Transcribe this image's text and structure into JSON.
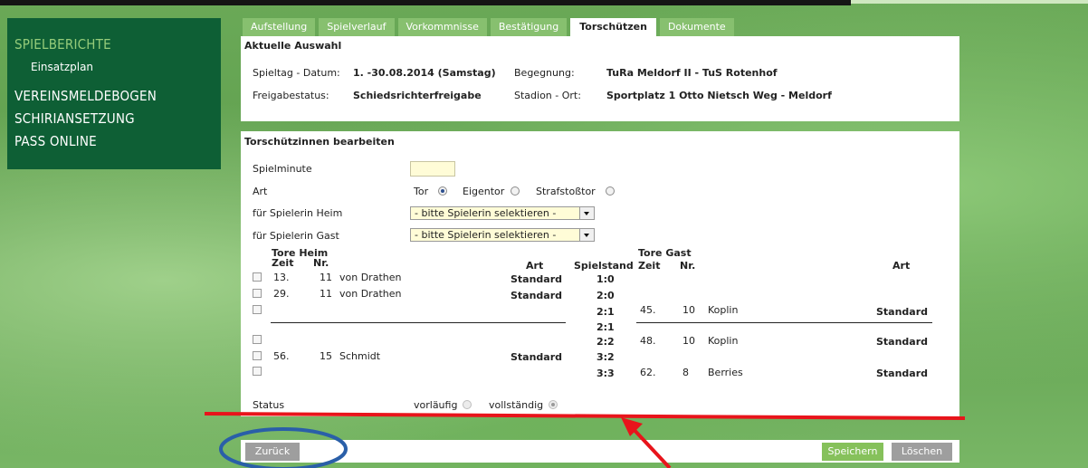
{
  "sidebar": {
    "items": [
      {
        "label": "SPIELBERICHTE"
      },
      {
        "label": "VEREINSMELDEBOGEN"
      },
      {
        "label": "SCHIRIANSETZUNG"
      },
      {
        "label": "PASS ONLINE"
      }
    ],
    "sub_item": "Einsatzplan"
  },
  "tabs": [
    {
      "label": "Aufstellung"
    },
    {
      "label": "Spielverlauf"
    },
    {
      "label": "Vorkommnisse"
    },
    {
      "label": "Bestätigung"
    },
    {
      "label": "Torschützen"
    },
    {
      "label": "Dokumente"
    }
  ],
  "selection": {
    "title": "Aktuelle Auswahl",
    "matchday_label": "Spieltag - Datum:",
    "matchday_value": "1. -30.08.2014 (Samstag)",
    "match_label": "Begegnung:",
    "match_value": "TuRa Meldorf II - TuS Rotenhof",
    "release_label": "Freigabestatus:",
    "release_value": "Schiedsrichterfreigabe",
    "venue_label": "Stadion - Ort:",
    "venue_value": "Sportplatz 1 Otto Nietsch Weg - Meldorf"
  },
  "editor": {
    "title": "Torschützinnen bearbeiten",
    "minute_label": "Spielminute",
    "minute_value": "",
    "type_label": "Art",
    "type_options": [
      "Tor",
      "Eigentor",
      "Strafstoßtor"
    ],
    "home_player_label": "für Spielerin Heim",
    "away_player_label": "für Spielerin Gast",
    "player_placeholder": "- bitte Spielerin selektieren -",
    "status_label": "Status",
    "status_options": [
      "vorläufig",
      "vollständig"
    ]
  },
  "goals": {
    "home_header": "Tore Heim",
    "away_header": "Tore Gast",
    "col_time": "Zeit",
    "col_number": "Nr.",
    "col_type": "Art",
    "col_score": "Spielstand",
    "rows": [
      {
        "home_time": "13.",
        "home_nr": "11",
        "home_name": "von Drathen",
        "home_type": "Standard",
        "score": "1:0",
        "away_time": "",
        "away_nr": "",
        "away_name": "",
        "away_type": ""
      },
      {
        "home_time": "29.",
        "home_nr": "11",
        "home_name": "von Drathen",
        "home_type": "Standard",
        "score": "2:0",
        "away_time": "",
        "away_nr": "",
        "away_name": "",
        "away_type": ""
      },
      {
        "home_time": "",
        "home_nr": "",
        "home_name": "",
        "home_type": "",
        "score": "2:1",
        "away_time": "45.",
        "away_nr": "10",
        "away_name": "Koplin",
        "away_type": "Standard"
      },
      {
        "home_time": "",
        "home_nr": "",
        "home_name": "",
        "home_type": "",
        "score": "2:1",
        "away_time": "",
        "away_nr": "",
        "away_name": "",
        "away_type": ""
      },
      {
        "home_time": "",
        "home_nr": "",
        "home_name": "",
        "home_type": "",
        "score": "2:2",
        "away_time": "48.",
        "away_nr": "10",
        "away_name": "Koplin",
        "away_type": "Standard"
      },
      {
        "home_time": "56.",
        "home_nr": "15",
        "home_name": "Schmidt",
        "home_type": "Standard",
        "score": "3:2",
        "away_time": "",
        "away_nr": "",
        "away_name": "",
        "away_type": ""
      },
      {
        "home_time": "",
        "home_nr": "",
        "home_name": "",
        "home_type": "",
        "score": "3:3",
        "away_time": "62.",
        "away_nr": "8",
        "away_name": "Berries",
        "away_type": "Standard"
      }
    ]
  },
  "buttons": {
    "back": "Zurück",
    "save": "Speichern",
    "delete": "Löschen"
  },
  "colors": {
    "sidebar_bg": "#0e5f35",
    "sidebar_active": "#96cc7a",
    "tab_bg": "#87c06f",
    "save_button": "#86c15b",
    "annotation_red": "#e8141b",
    "annotation_blue": "#2a5fa8"
  }
}
